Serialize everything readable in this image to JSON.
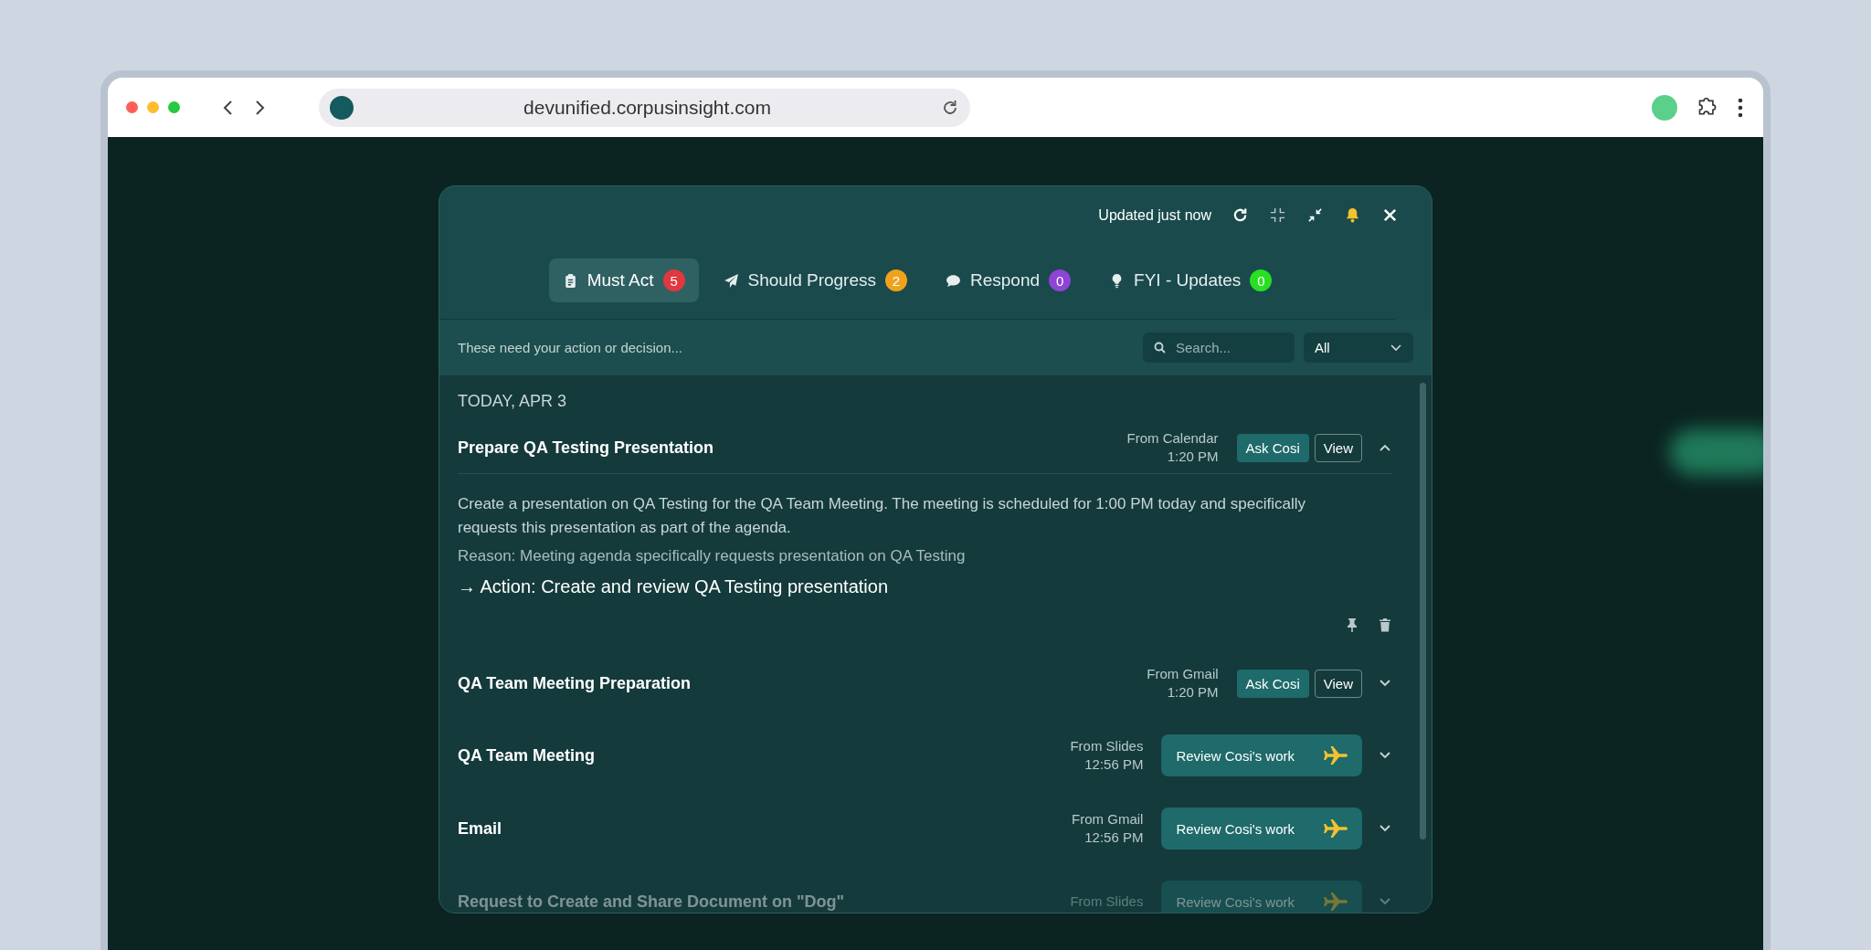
{
  "browser": {
    "url": "devunified.corpusinsight.com"
  },
  "panel": {
    "status": "Updated just now",
    "tabs": [
      {
        "label": "Must Act",
        "count": "5",
        "color": "#e0383e",
        "kind": "clipboard",
        "selected": true
      },
      {
        "label": "Should Progress",
        "count": "2",
        "color": "#f0a21c",
        "kind": "send",
        "selected": false
      },
      {
        "label": "Respond",
        "count": "0",
        "color": "#8e44d6",
        "kind": "chat",
        "selected": false
      },
      {
        "label": "FYI - Updates",
        "count": "0",
        "color": "#27e023",
        "kind": "bulb",
        "selected": false
      }
    ],
    "hint": "These need your action or decision...",
    "search": {
      "placeholder": "Search..."
    },
    "filter": {
      "value": "All"
    },
    "date_header": "TODAY, APR 3",
    "items": [
      {
        "title": "Prepare QA Testing Presentation",
        "source": "From Calendar",
        "time": "1:20 PM",
        "kind": "ask_view",
        "ask": "Ask Cosi",
        "view": "View",
        "expanded": true,
        "description": "Create a presentation on QA Testing for the QA Team Meeting. The meeting is scheduled for 1:00 PM today and specifically requests this presentation as part of the agenda.",
        "reason": "Reason: Meeting agenda specifically requests presentation on QA Testing",
        "action": "→ Action: Create and review QA Testing presentation"
      },
      {
        "title": "QA Team Meeting Preparation",
        "source": "From Gmail",
        "time": "1:20 PM",
        "kind": "ask_view",
        "ask": "Ask Cosi",
        "view": "View",
        "expanded": false
      },
      {
        "title": "QA Team Meeting",
        "source": "From Slides",
        "time": "12:56 PM",
        "kind": "review",
        "review": "Review Cosi's work",
        "expanded": false
      },
      {
        "title": "Email",
        "source": "From Gmail",
        "time": "12:56 PM",
        "kind": "review",
        "review": "Review Cosi's work",
        "expanded": false
      },
      {
        "title": "Request to Create and Share Document on \"Dog\"",
        "source": "From Slides",
        "kind": "review",
        "review": "Review Cosi's work",
        "expanded": false
      }
    ]
  }
}
